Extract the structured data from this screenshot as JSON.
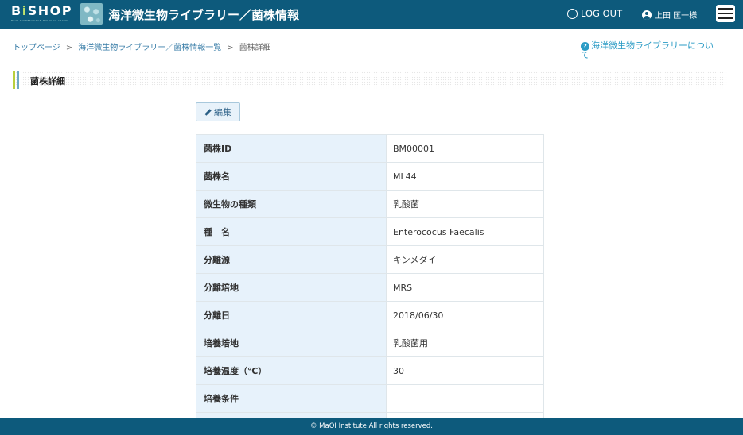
{
  "header": {
    "logo_text_a": "B",
    "logo_text_i": "i",
    "logo_text_b": "SHOP",
    "logo_subtitle": "BLUE BIORESOURCE HOLDING ARCHIVE & PLATFORM",
    "title": "海洋微生物ライブラリー／菌株情報",
    "logout_label": "LOG OUT",
    "user_name": "上田 匡一様"
  },
  "breadcrumb": [
    "トップページ",
    "海洋微生物ライブラリー／菌株情報一覧",
    "菌株詳細"
  ],
  "breadcrumb_separator": ">",
  "about_link": "海洋微生物ライブラリーについて",
  "section_title": "菌株詳細",
  "edit_button": "編集",
  "details": [
    {
      "label": "菌株ID",
      "value": "BM00001"
    },
    {
      "label": "菌株名",
      "value": "ML44"
    },
    {
      "label": "微生物の種類",
      "value": "乳酸菌"
    },
    {
      "label": "種　名",
      "value": "Enterococus Faecalis"
    },
    {
      "label": "分離源",
      "value": "キンメダイ"
    },
    {
      "label": "分離培地",
      "value": "MRS"
    },
    {
      "label": "分離日",
      "value": "2018/06/30"
    },
    {
      "label": "培養培地",
      "value": "乳酸菌用"
    },
    {
      "label": "培養温度（℃）",
      "value": "30"
    },
    {
      "label": "培養条件",
      "value": ""
    },
    {
      "label": "",
      "value": ""
    }
  ],
  "footer": "© MaOI Institute All rights reserved.",
  "colors": {
    "header_bg": "#0d5a7c",
    "link": "#3a7ea8",
    "accent_green": "#b9cf3d",
    "table_key_bg": "#e7f2fb"
  }
}
